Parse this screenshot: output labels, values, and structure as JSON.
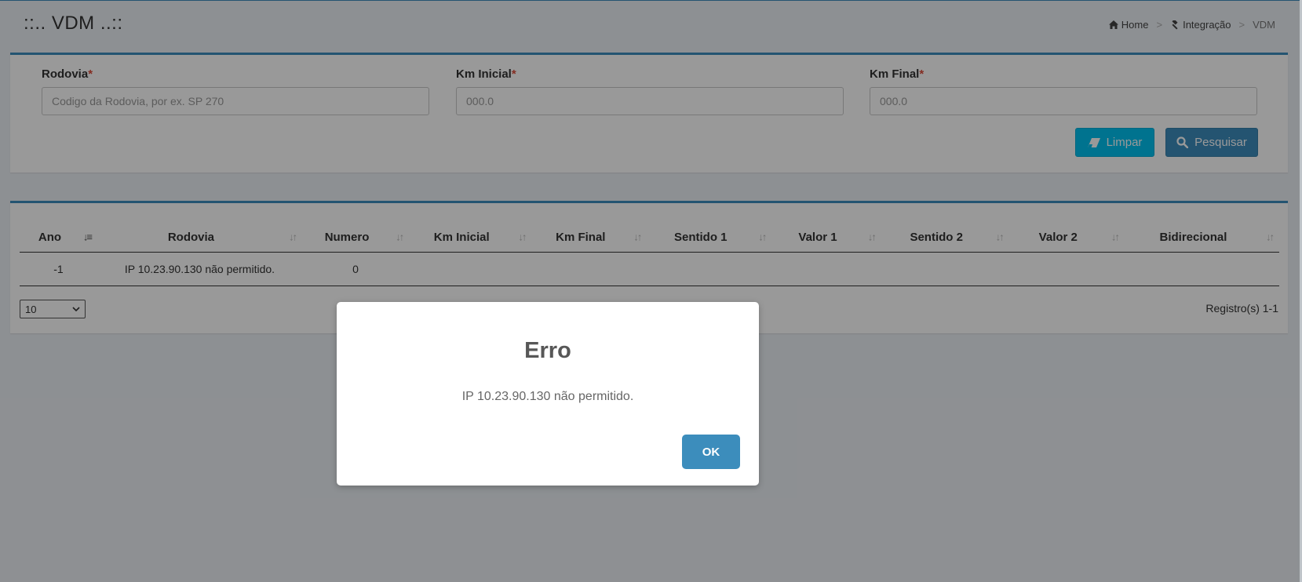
{
  "header": {
    "title": "::.. VDM ..::",
    "breadcrumb": [
      {
        "label": "Home",
        "icon": "home-icon"
      },
      {
        "label": "Integração",
        "icon": "gavel-icon"
      },
      {
        "label": "VDM"
      }
    ]
  },
  "filter": {
    "rodovia": {
      "label": "Rodovia",
      "required_mark": "*",
      "placeholder": "Codigo da Rodovia, por ex. SP 270",
      "value": ""
    },
    "km_inicial": {
      "label": "Km Inicial",
      "required_mark": "*",
      "placeholder": "000.0",
      "value": ""
    },
    "km_final": {
      "label": "Km Final",
      "required_mark": "*",
      "placeholder": "000.0",
      "value": ""
    },
    "buttons": {
      "limpar": "Limpar",
      "pesquisar": "Pesquisar"
    }
  },
  "table": {
    "columns": [
      "Ano",
      "Rodovia",
      "Numero",
      "Km Inicial",
      "Km Final",
      "Sentido 1",
      "Valor 1",
      "Sentido 2",
      "Valor 2",
      "Bidirecional"
    ],
    "rows": [
      [
        "-1",
        "IP 10.23.90.130 não permitido.",
        "0",
        "",
        "",
        "",
        "",
        "",
        "",
        ""
      ]
    ],
    "page_size": "10",
    "records_info": "Registro(s) 1-1"
  },
  "modal": {
    "title": "Erro",
    "message": "IP 10.23.90.130 não permitido.",
    "ok_label": "OK"
  },
  "colors": {
    "primary": "#3c8dbc",
    "info": "#00c0ef",
    "required": "#dd4b39"
  }
}
